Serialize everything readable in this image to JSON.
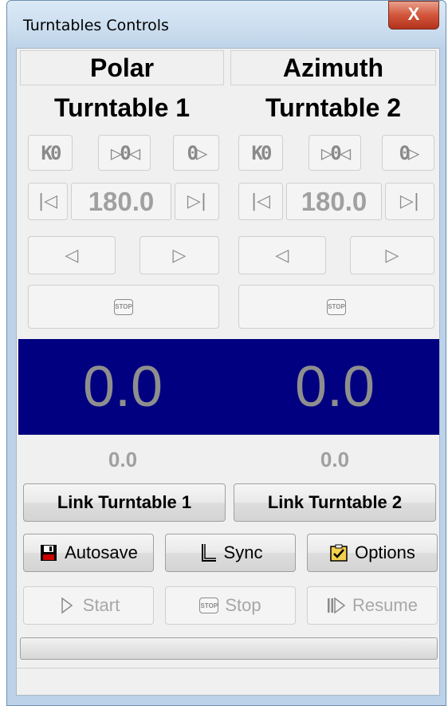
{
  "window": {
    "title": "Turntables Controls",
    "close_glyph": "X"
  },
  "headers": {
    "left": "Polar",
    "right": "Azimuth"
  },
  "turntables": [
    {
      "title": "Turntable 1",
      "home_glyph": "K0",
      "center_glyph": "▷0◁",
      "end_glyph": "0▷",
      "step_back_glyph": "|◁",
      "step_forward_glyph": "▷|",
      "step_value": "180.0",
      "jog_left_glyph": "◁",
      "jog_right_glyph": "▷",
      "stop_glyph": "STOP",
      "position": "0.0",
      "target": "0.0",
      "link_label": "Link Turntable 1"
    },
    {
      "title": "Turntable 2",
      "home_glyph": "K0",
      "center_glyph": "▷0◁",
      "end_glyph": "0▷",
      "step_back_glyph": "|◁",
      "step_forward_glyph": "▷|",
      "step_value": "180.0",
      "jog_left_glyph": "◁",
      "jog_right_glyph": "▷",
      "stop_glyph": "STOP",
      "position": "0.0",
      "target": "0.0",
      "link_label": "Link Turntable 2"
    }
  ],
  "toolbar": {
    "autosave_label": "Autosave",
    "sync_label": "Sync",
    "options_label": "Options",
    "start_label": "Start",
    "stop_label": "Stop",
    "resume_label": "Resume",
    "stop_icon_text": "STOP"
  },
  "colors": {
    "display_bg": "#000080",
    "display_text": "#8e8e8e",
    "disabled_text": "#a7a7a7"
  },
  "progress": 0
}
